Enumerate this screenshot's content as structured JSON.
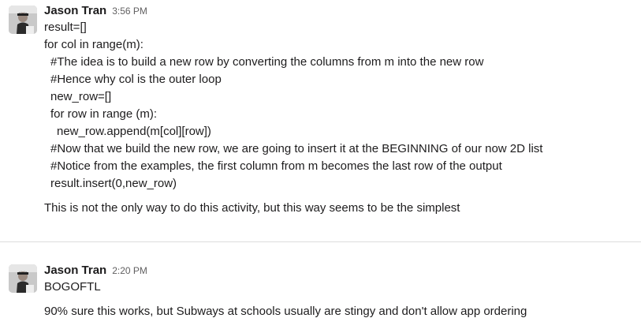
{
  "messages": [
    {
      "sender": "Jason Tran",
      "time": "3:56 PM",
      "code_lines": [
        "result=[]",
        "for col in range(m):",
        "  #The idea is to build a new row by converting the columns from m into the new row",
        "  #Hence why col is the outer loop",
        "  new_row=[]",
        "  for row in range (m):",
        "    new_row.append(m[col][row])",
        "  #Now that we build the new row, we are going to insert it at the BEGINNING of our now 2D list",
        "  #Notice from the examples, the first column from m becomes the last row of the output",
        "  result.insert(0,new_row)"
      ],
      "text": "This is not the only way to do this activity, but this way seems to be the simplest"
    },
    {
      "sender": "Jason Tran",
      "time": "2:20 PM",
      "code_lines": [
        "BOGOFTL"
      ],
      "text": "90% sure this works,  but Subways at schools usually are stingy and don't allow app ordering"
    }
  ]
}
